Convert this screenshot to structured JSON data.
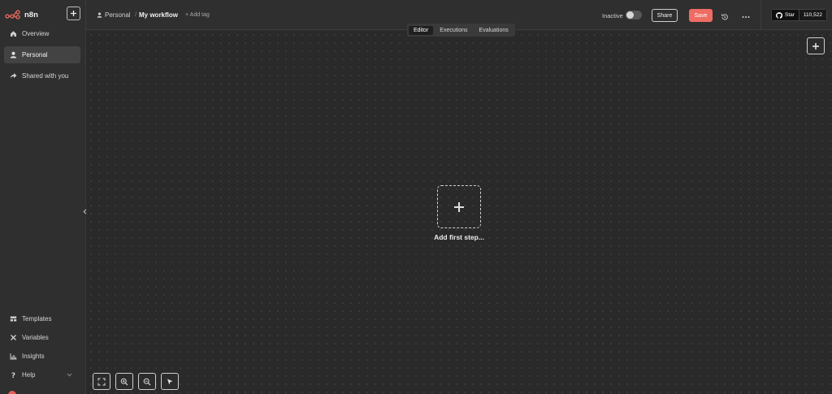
{
  "brand": {
    "name": "n8n",
    "accent": "#ee6c63"
  },
  "sidebar": {
    "top_items": [
      {
        "label": "Overview",
        "icon": "home-icon",
        "active": false
      },
      {
        "label": "Personal",
        "icon": "user-icon",
        "active": true
      },
      {
        "label": "Shared with you",
        "icon": "share-icon",
        "active": false
      }
    ],
    "bottom_items": [
      {
        "label": "Templates",
        "icon": "templates-icon"
      },
      {
        "label": "Variables",
        "icon": "variables-icon"
      },
      {
        "label": "Insights",
        "icon": "insights-icon"
      },
      {
        "label": "Help",
        "icon": "help-icon"
      }
    ]
  },
  "header": {
    "project": "Personal",
    "workflow_name": "My workflow",
    "add_tag": "+ Add tag",
    "status_label": "Inactive",
    "share_label": "Share",
    "save_label": "Save",
    "github": {
      "star_label": "Star",
      "count": "110,522"
    }
  },
  "tabs": [
    {
      "label": "Editor",
      "active": true
    },
    {
      "label": "Executions",
      "active": false
    },
    {
      "label": "Evaluations",
      "active": false
    }
  ],
  "canvas": {
    "add_first_step": "Add first step..."
  }
}
